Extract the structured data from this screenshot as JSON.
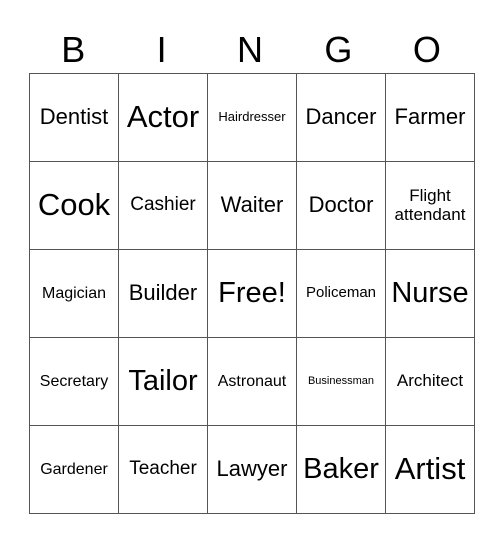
{
  "header": [
    "B",
    "I",
    "N",
    "G",
    "O"
  ],
  "rows": [
    [
      "Dentist",
      "Actor",
      "Hairdresser",
      "Dancer",
      "Farmer"
    ],
    [
      "Cook",
      "Cashier",
      "Waiter",
      "Doctor",
      "Flight attendant"
    ],
    [
      "Magician",
      "Builder",
      "Free!",
      "Policeman",
      "Nurse"
    ],
    [
      "Secretary",
      "Tailor",
      "Astronaut",
      "Businessman",
      "Architect"
    ],
    [
      "Gardener",
      "Teacher",
      "Lawyer",
      "Baker",
      "Artist"
    ]
  ]
}
